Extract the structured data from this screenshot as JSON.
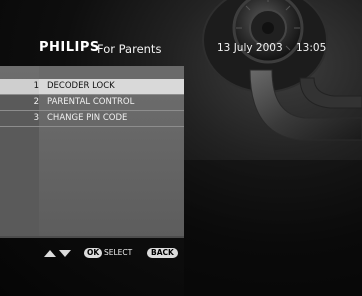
{
  "header": {
    "brand": "PHILIPS",
    "section_title": "For Parents",
    "date": "13 July 2003",
    "time": "13:05"
  },
  "menu": {
    "items": [
      {
        "number": "1",
        "label": "DECODER LOCK",
        "selected": true
      },
      {
        "number": "2",
        "label": "PARENTAL CONTROL",
        "selected": false
      },
      {
        "number": "3",
        "label": "CHANGE PIN CODE",
        "selected": false
      }
    ]
  },
  "footer": {
    "nav_icon": "up-down-arrows-icon",
    "ok_key": "OK",
    "ok_label": "SELECT",
    "back_key": "BACK"
  },
  "colors": {
    "panel": "#666666",
    "selected_row": "#d9d9d9",
    "background": "#0e0e0e"
  }
}
